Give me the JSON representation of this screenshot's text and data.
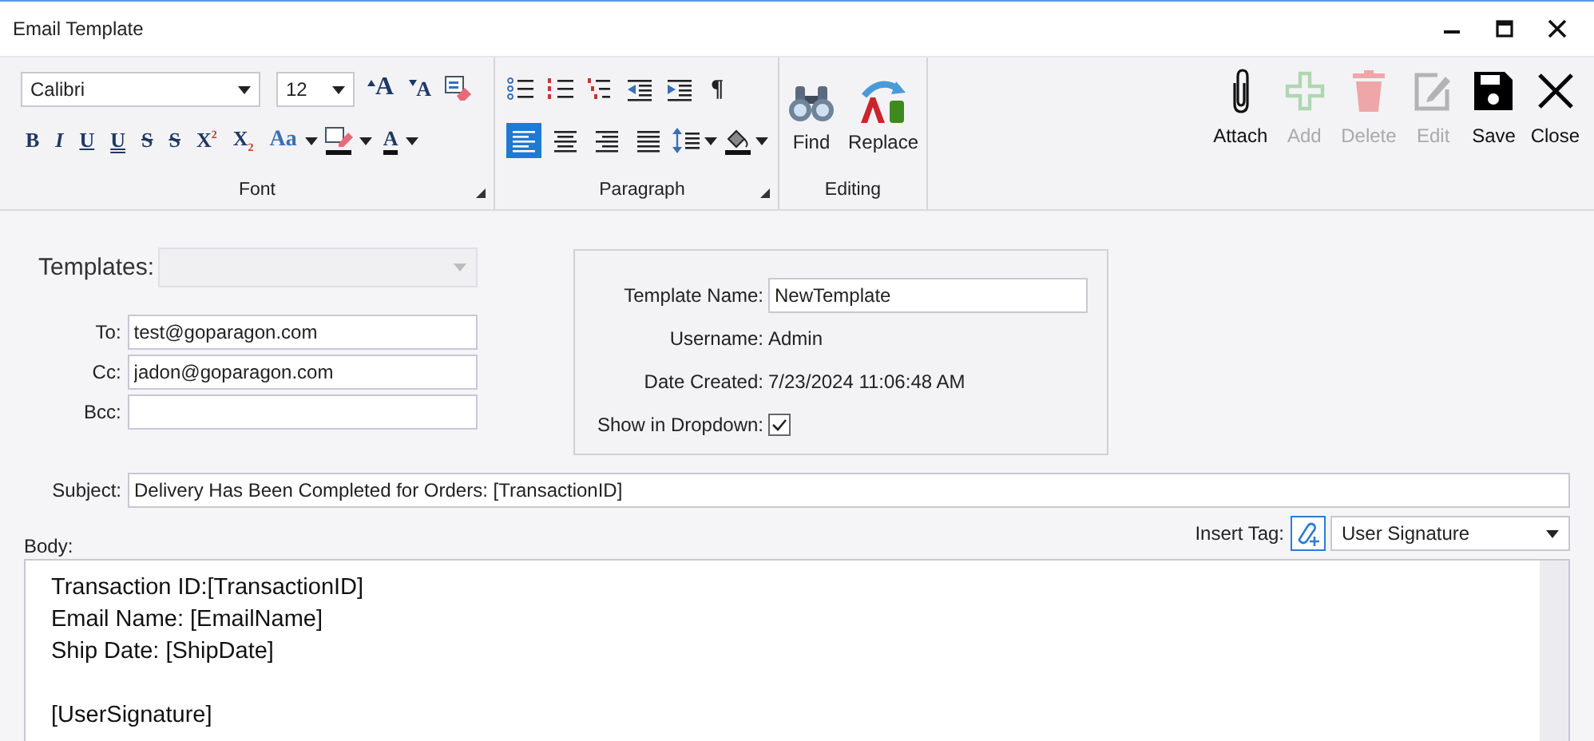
{
  "window": {
    "title": "Email Template"
  },
  "ribbon": {
    "font": {
      "label": "Font",
      "font_name": "Calibri",
      "font_size": "12",
      "size_buttons": [
        {
          "kind": "grow",
          "glyph": "A"
        },
        {
          "kind": "shrink",
          "glyph": "A"
        },
        {
          "kind": "clear"
        }
      ],
      "format_buttons": [
        {
          "kind": "bold",
          "glyph": "B"
        },
        {
          "kind": "italic",
          "glyph": "I"
        },
        {
          "kind": "underline",
          "glyph": "U"
        },
        {
          "kind": "double-underline",
          "glyph": "U"
        },
        {
          "kind": "strike",
          "glyph": "S"
        },
        {
          "kind": "double-strike",
          "glyph": "S"
        },
        {
          "kind": "superscript",
          "glyph": "X$^{2}$"
        },
        {
          "kind": "subscript",
          "glyph": "X$_{2}$"
        },
        {
          "kind": "case",
          "glyph": "Aa"
        },
        {
          "kind": "highlight"
        },
        {
          "kind": "font-color",
          "glyph": "A"
        }
      ]
    },
    "paragraph": {
      "label": "Paragraph",
      "list_buttons": [
        {
          "kind": "bullets"
        },
        {
          "kind": "numbering"
        },
        {
          "kind": "multilevel"
        },
        {
          "kind": "outdent"
        },
        {
          "kind": "indent"
        },
        {
          "kind": "pilcrow",
          "glyph": "¶"
        }
      ],
      "alignments": [
        {
          "kind": "left",
          "selected": true
        },
        {
          "kind": "center",
          "selected": false
        },
        {
          "kind": "right",
          "selected": false
        },
        {
          "kind": "justify",
          "selected": false
        }
      ],
      "spacing_tools": [
        {
          "kind": "line-spacing"
        },
        {
          "kind": "shading"
        }
      ]
    },
    "editing": {
      "label": "Editing",
      "buttons": [
        {
          "kind": "find",
          "label": "Find"
        },
        {
          "kind": "replace",
          "label": "Replace"
        }
      ]
    },
    "actions": [
      {
        "kind": "attach",
        "label": "Attach",
        "disabled": false
      },
      {
        "kind": "add",
        "label": "Add",
        "disabled": true
      },
      {
        "kind": "delete",
        "label": "Delete",
        "disabled": true
      },
      {
        "kind": "edit",
        "label": "Edit",
        "disabled": true
      },
      {
        "kind": "save",
        "label": "Save",
        "disabled": false
      },
      {
        "kind": "close",
        "label": "Close",
        "disabled": false
      }
    ]
  },
  "form": {
    "templates": {
      "label": "Templates:",
      "disabled": true
    },
    "recipients": [
      {
        "label": "To:",
        "value": "test@goparagon.com"
      },
      {
        "label": "Cc:",
        "value": "jadon@goparagon.com"
      },
      {
        "label": "Bcc:"
      }
    ],
    "details": [
      {
        "kind": "field",
        "label": "Template Name:",
        "value": "NewTemplate"
      },
      {
        "kind": "text",
        "label": "Username:",
        "value": "Admin"
      },
      {
        "kind": "text",
        "label": "Date Created:",
        "value": "7/23/2024 11:06:48 AM"
      },
      {
        "kind": "check",
        "label": "Show in Dropdown:",
        "checked": true
      }
    ],
    "subject": {
      "label": "Subject:",
      "value": "Delivery Has Been Completed for Orders: [TransactionID]"
    },
    "body_label": "Body:",
    "insert_tag": {
      "label": "Insert Tag:",
      "value": "User Signature"
    },
    "body": [
      {
        "lines": [
          "Transaction ID:[TransactionID]",
          "Email Name: [EmailName]",
          "Ship Date: [ShipDate]"
        ]
      },
      {
        "lines": [
          "[UserSignature]"
        ]
      }
    ]
  }
}
